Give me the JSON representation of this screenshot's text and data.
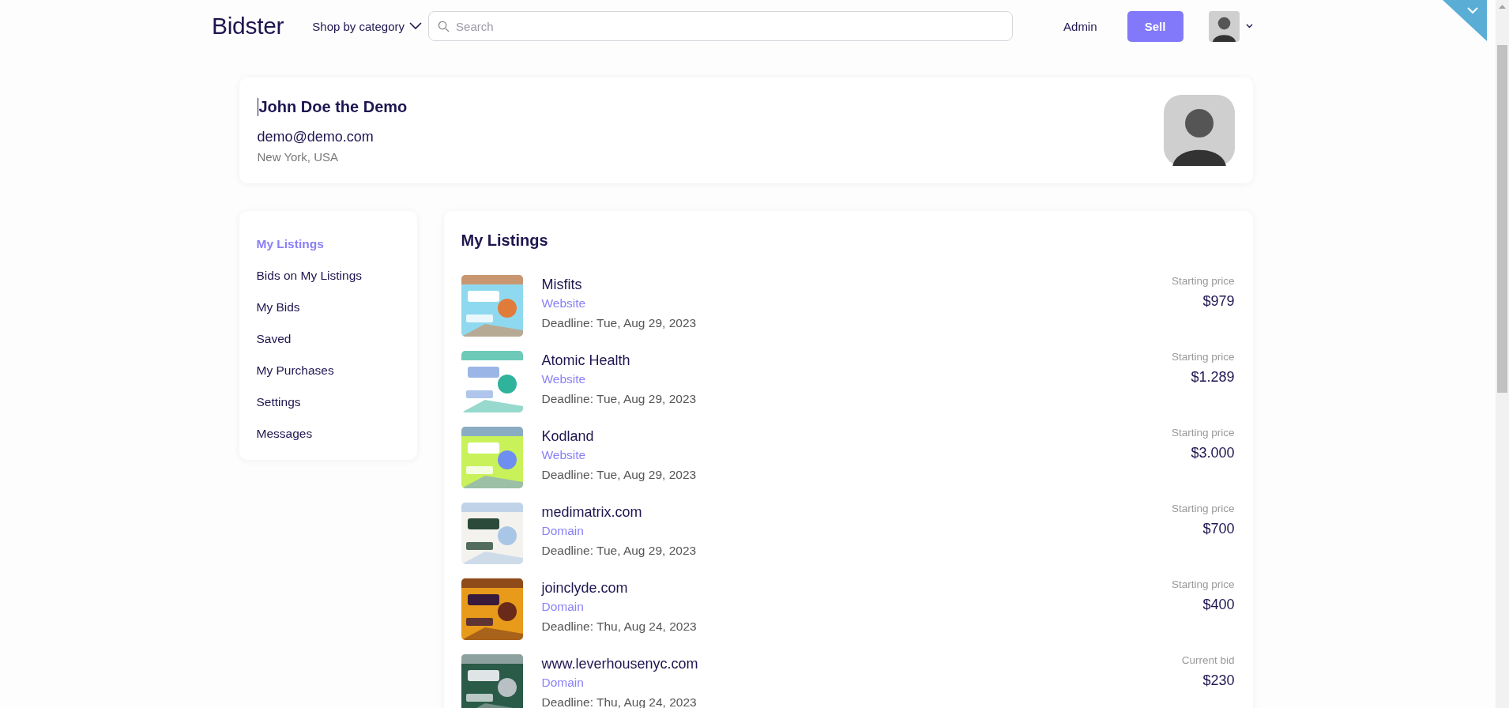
{
  "header": {
    "logo": "Bidster",
    "category_menu": "Shop by category",
    "search": {
      "placeholder": "Search"
    },
    "admin_link": "Admin",
    "sell_button": "Sell"
  },
  "profile": {
    "name": "John Doe the Demo",
    "email": "demo@demo.com",
    "location": "New York, USA"
  },
  "sidebar": {
    "items": [
      {
        "label": "My Listings",
        "selected": true
      },
      {
        "label": "Bids on My Listings",
        "selected": false
      },
      {
        "label": "My Bids",
        "selected": false
      },
      {
        "label": "Saved",
        "selected": false
      },
      {
        "label": "My Purchases",
        "selected": false
      },
      {
        "label": "Settings",
        "selected": false
      },
      {
        "label": "Messages",
        "selected": false
      }
    ]
  },
  "listings": {
    "title": "My Listings",
    "items": [
      {
        "name": "Misfits",
        "type": "Website",
        "deadline": "Deadline: Tue, Aug 29, 2023",
        "price_label": "Starting price",
        "price": "$979"
      },
      {
        "name": "Atomic Health",
        "type": "Website",
        "deadline": "Deadline: Tue, Aug 29, 2023",
        "price_label": "Starting price",
        "price": "$1.289"
      },
      {
        "name": "Kodland",
        "type": "Website",
        "deadline": "Deadline: Tue, Aug 29, 2023",
        "price_label": "Starting price",
        "price": "$3.000"
      },
      {
        "name": "medimatrix.com",
        "type": "Domain",
        "deadline": "Deadline: Tue, Aug 29, 2023",
        "price_label": "Starting price",
        "price": "$700"
      },
      {
        "name": "joinclyde.com",
        "type": "Domain",
        "deadline": "Deadline: Thu, Aug 24, 2023",
        "price_label": "Starting price",
        "price": "$400"
      },
      {
        "name": "www.leverhousenyc.com",
        "type": "Domain",
        "deadline": "Deadline: Thu, Aug 24, 2023",
        "price_label": "Current bid",
        "price": "$230"
      }
    ]
  }
}
